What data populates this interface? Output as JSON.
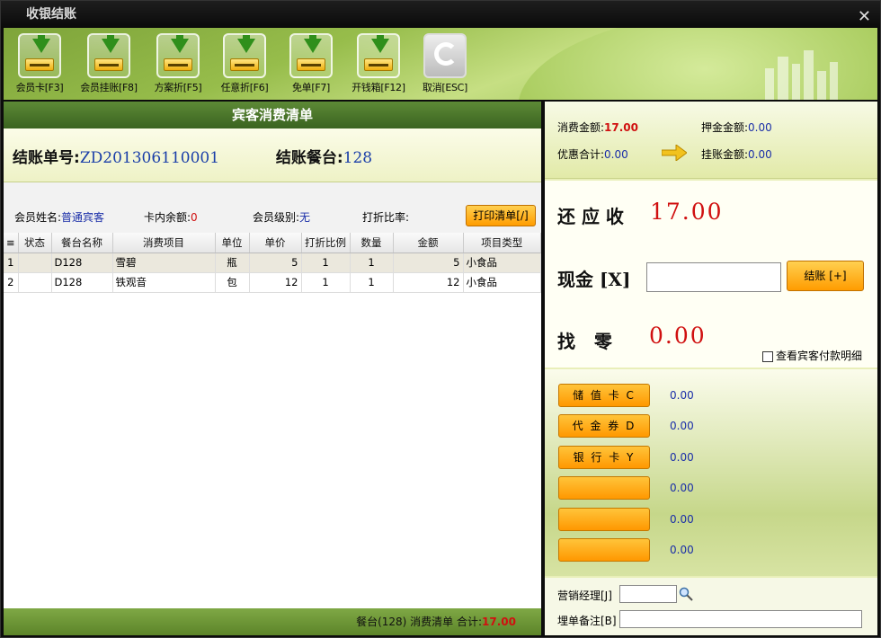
{
  "window": {
    "title": "收银结账",
    "close_glyph": "✕"
  },
  "toolbar": [
    {
      "label": "会员卡[F3]",
      "icon": "download-tray-icon"
    },
    {
      "label": "会员挂账[F8]",
      "icon": "download-tray-icon"
    },
    {
      "label": "方案折[F5]",
      "icon": "download-tray-icon"
    },
    {
      "label": "任意折[F6]",
      "icon": "download-tray-icon"
    },
    {
      "label": "免单[F7]",
      "icon": "download-tray-icon"
    },
    {
      "label": "开钱箱[F12]",
      "icon": "download-tray-icon"
    },
    {
      "label": "取消[ESC]",
      "icon": "refresh-icon"
    }
  ],
  "left": {
    "header": "宾客消费清单",
    "bill_no_label": "结账单号:",
    "bill_no": "ZD201306110001",
    "table_label": "结账餐台:",
    "table_no": "128",
    "member_name_label": "会员姓名:",
    "member_name": "普通宾客",
    "card_balance_label": "卡内余额:",
    "card_balance": "0",
    "member_level_label": "会员级别:",
    "member_level": "无",
    "discount_label": "打折比率:",
    "discount": "",
    "print_button": "打印清单[/]",
    "columns": [
      "状态",
      "餐台名称",
      "消费项目",
      "单位",
      "单价",
      "打折比例",
      "数量",
      "金额",
      "项目类型"
    ],
    "rows": [
      {
        "idx": "1",
        "status": "",
        "table": "D128",
        "item": "雪碧",
        "unit": "瓶",
        "price": "5",
        "ratio": "1",
        "qty": "1",
        "amount": "5",
        "type": "小食品"
      },
      {
        "idx": "2",
        "status": "",
        "table": "D128",
        "item": "铁观音",
        "unit": "包",
        "price": "12",
        "ratio": "1",
        "qty": "1",
        "amount": "12",
        "type": "小食品"
      }
    ],
    "footer_prefix": "餐台(128) 消费清单 合计:",
    "footer_total": "17.00"
  },
  "right": {
    "consume_label": "消费金额:",
    "consume": "17.00",
    "deposit_label": "押金金额:",
    "deposit": "0.00",
    "discount_total_label": "优惠合计:",
    "discount_total": "0.00",
    "credit_label": "挂账金额:",
    "credit": "0.00",
    "due_label": "还 应 收",
    "due": "17.00",
    "cash_label": "现金 [X]",
    "cash_value": "",
    "pay_button": "结账 [+]",
    "change_label": "找   零",
    "change": "0.00",
    "view_detail_label": "查看宾客付款明细",
    "payments": [
      {
        "label": "储 值 卡 C",
        "value": "0.00"
      },
      {
        "label": "代 金 券 D",
        "value": "0.00"
      },
      {
        "label": "银 行 卡 Y",
        "value": "0.00"
      },
      {
        "label": "",
        "value": "0.00"
      },
      {
        "label": "",
        "value": "0.00"
      },
      {
        "label": "",
        "value": "0.00"
      }
    ],
    "manager_label": "营销经理[J]",
    "manager_value": "",
    "note_label": "埋单备注[B]",
    "note_value": ""
  },
  "colors": {
    "accent_green": "#5d8a36",
    "button_orange": "#ff9c00",
    "amount_red": "#d01010",
    "value_blue": "#1a2ea8"
  }
}
